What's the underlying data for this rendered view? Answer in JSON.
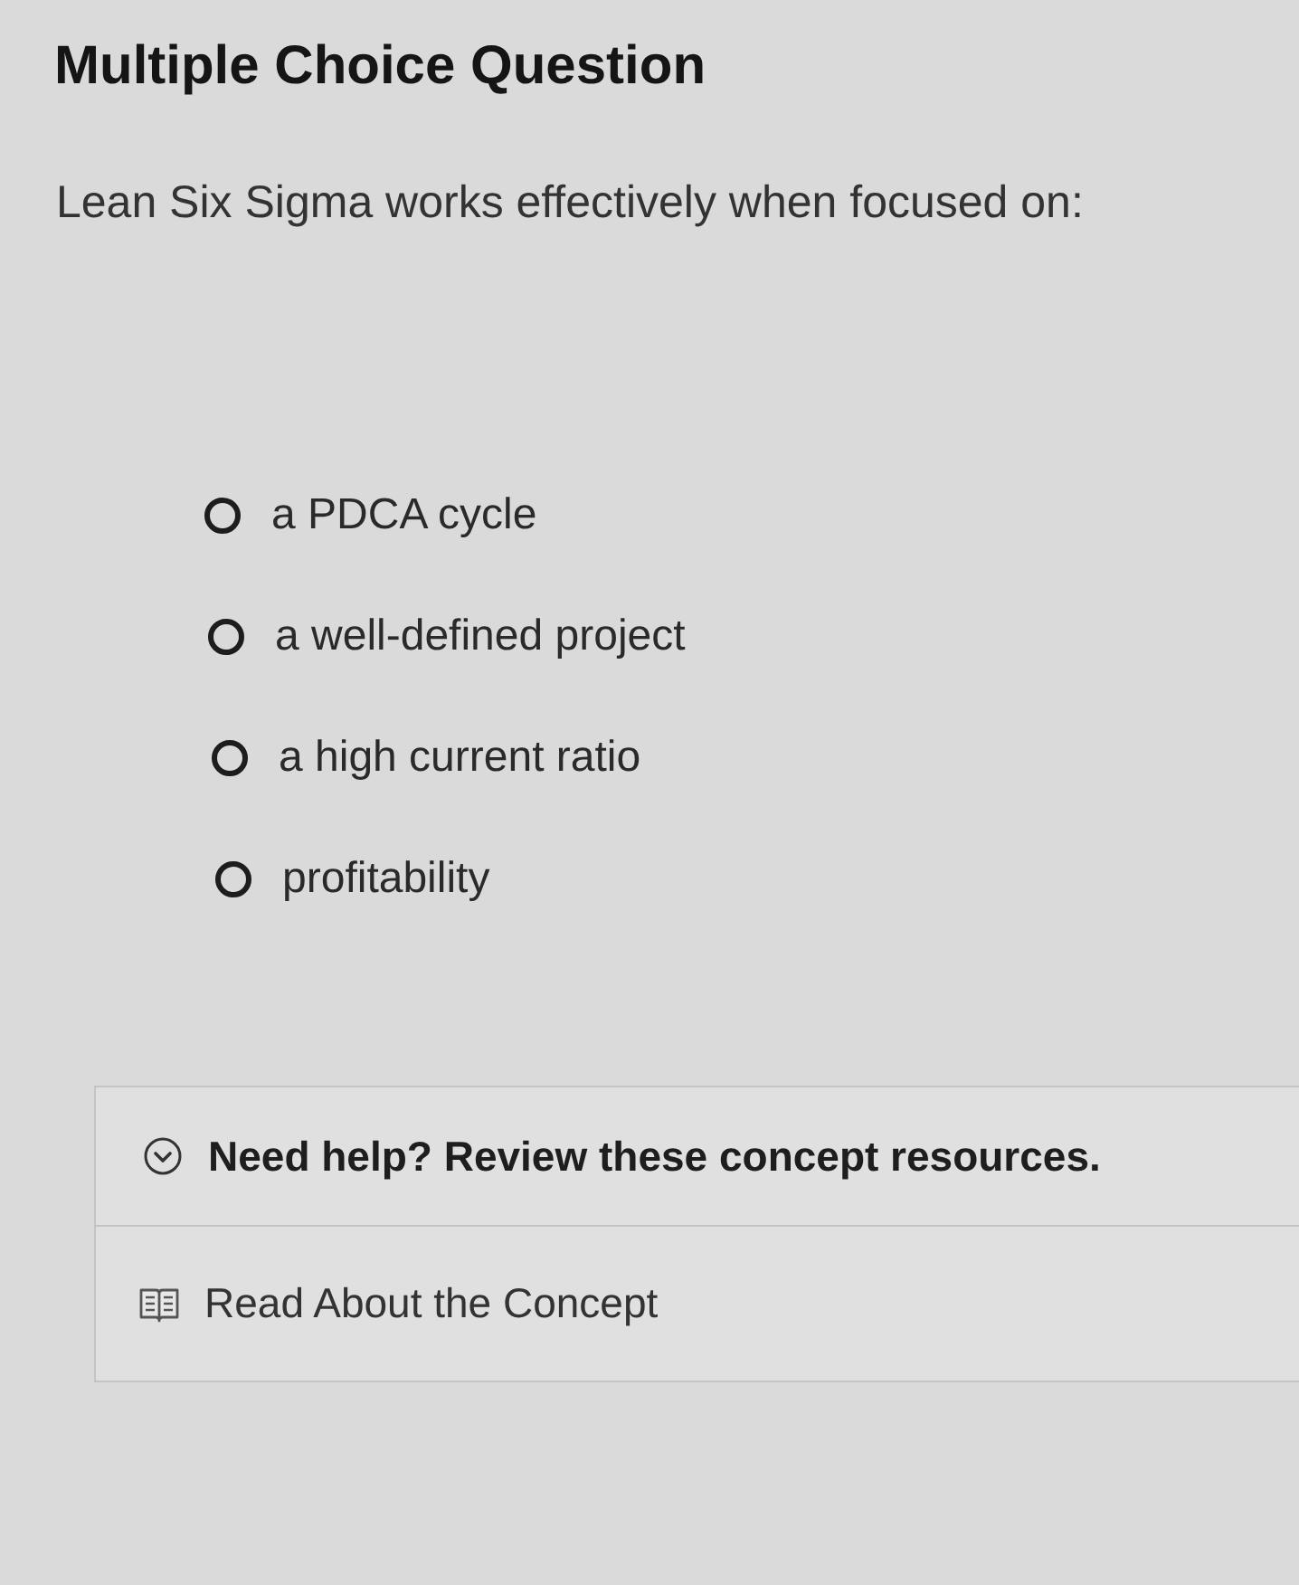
{
  "title": "Multiple Choice Question",
  "question": "Lean Six Sigma works effectively when focused on:",
  "options": [
    {
      "label": "a PDCA cycle",
      "selected": false
    },
    {
      "label": "a well-defined project",
      "selected": false
    },
    {
      "label": "a high current ratio",
      "selected": false
    },
    {
      "label": "profitability",
      "selected": false
    }
  ],
  "help": {
    "label": "Need help? Review these concept resources.",
    "expanded": true,
    "resources": [
      {
        "label": "Read About the Concept"
      }
    ]
  }
}
